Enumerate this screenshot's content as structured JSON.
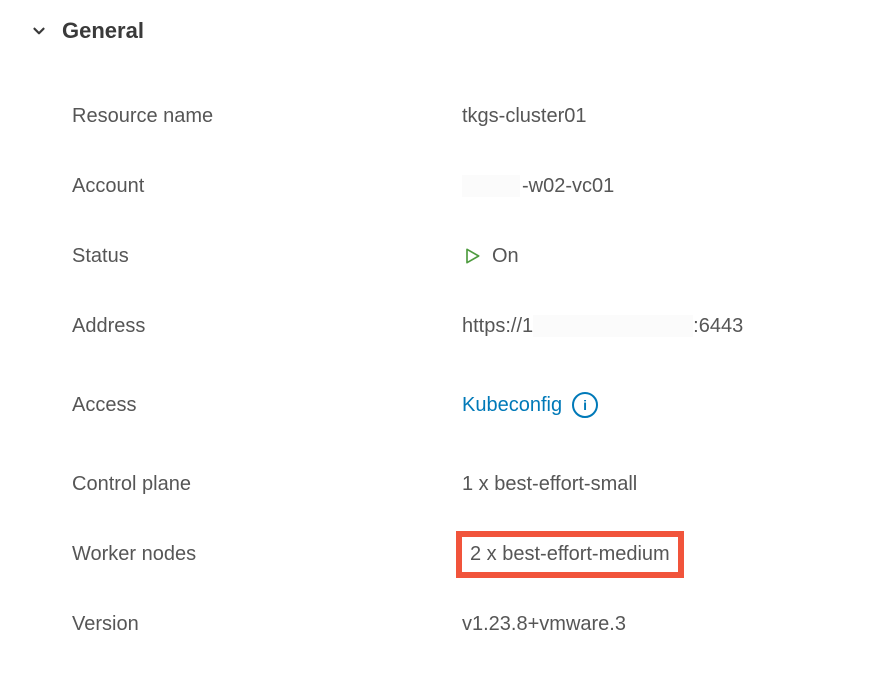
{
  "section": {
    "title": "General"
  },
  "rows": {
    "resource_name": {
      "label": "Resource name",
      "value": "tkgs-cluster01"
    },
    "account": {
      "label": "Account",
      "suffix": "-w02-vc01"
    },
    "status": {
      "label": "Status",
      "value": "On"
    },
    "address": {
      "label": "Address",
      "prefix": "https://1",
      "suffix": ":6443"
    },
    "access": {
      "label": "Access",
      "link_text": "Kubeconfig"
    },
    "control_plane": {
      "label": "Control plane",
      "value": "1 x best-effort-small"
    },
    "worker_nodes": {
      "label": "Worker nodes",
      "value": "2 x best-effort-medium"
    },
    "version": {
      "label": "Version",
      "value": "v1.23.8+vmware.3"
    }
  }
}
